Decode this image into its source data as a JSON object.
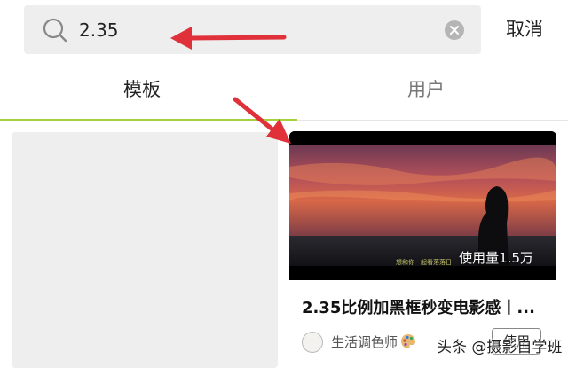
{
  "search": {
    "query": "2.35",
    "cancel_label": "取消"
  },
  "tabs": [
    {
      "label": "模板",
      "active": true
    },
    {
      "label": "用户",
      "active": false
    }
  ],
  "result_card": {
    "usage": "使用量1.5万",
    "thumbnail_caption": "想和你一起看落落日",
    "title": "2.35比例加黑框秒变电影感丨...",
    "author": "生活调色师",
    "author_emoji": "palette-icon",
    "use_label": "使用"
  },
  "watermark": "头条 @摄影自学班",
  "colors": {
    "accent": "#a7d13b",
    "annotation_arrow": "#e0303a",
    "search_bg": "#eeeeee"
  }
}
